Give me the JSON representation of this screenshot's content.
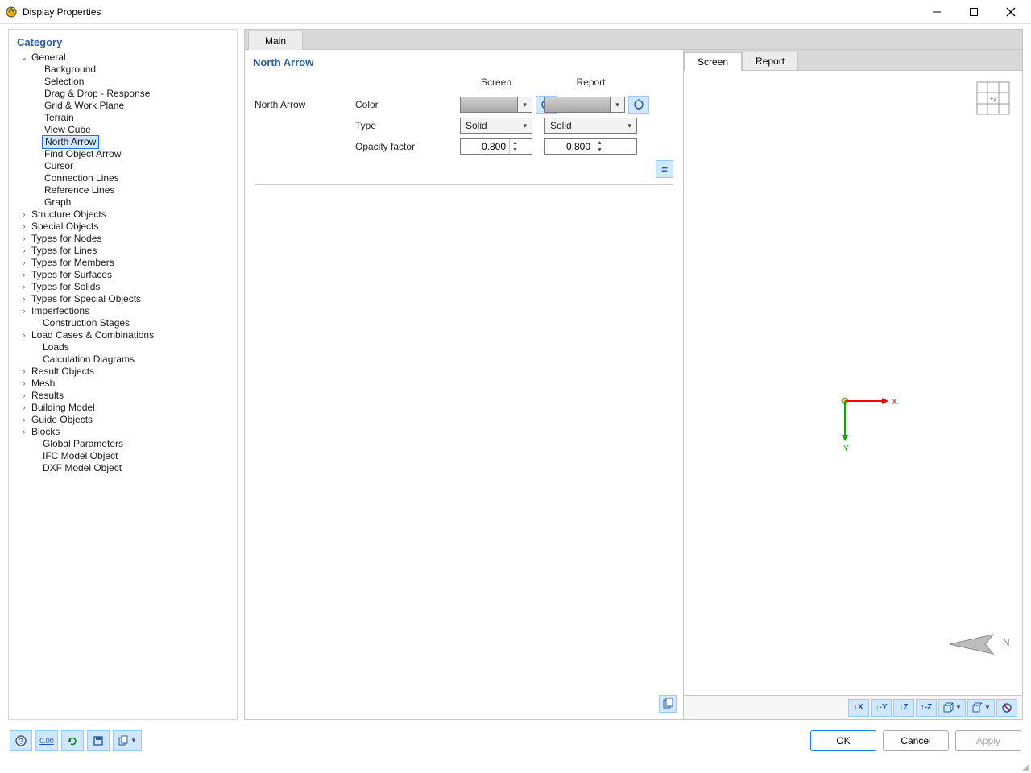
{
  "window": {
    "title": "Display Properties"
  },
  "sidebar": {
    "header": "Category",
    "tree": [
      {
        "label": "General",
        "level": 0,
        "expander": "v"
      },
      {
        "label": "Background",
        "level": 1
      },
      {
        "label": "Selection",
        "level": 1
      },
      {
        "label": "Drag & Drop - Response",
        "level": 1
      },
      {
        "label": "Grid & Work Plane",
        "level": 1
      },
      {
        "label": "Terrain",
        "level": 1
      },
      {
        "label": "View Cube",
        "level": 1
      },
      {
        "label": "North Arrow",
        "level": 1,
        "selected": true
      },
      {
        "label": "Find Object Arrow",
        "level": 1
      },
      {
        "label": "Cursor",
        "level": 1
      },
      {
        "label": "Connection Lines",
        "level": 1
      },
      {
        "label": "Reference Lines",
        "level": 1
      },
      {
        "label": "Graph",
        "level": 1
      },
      {
        "label": "Structure Objects",
        "level": 0,
        "expander": ">"
      },
      {
        "label": "Special Objects",
        "level": 0,
        "expander": ">"
      },
      {
        "label": "Types for Nodes",
        "level": 0,
        "expander": ">"
      },
      {
        "label": "Types for Lines",
        "level": 0,
        "expander": ">"
      },
      {
        "label": "Types for Members",
        "level": 0,
        "expander": ">"
      },
      {
        "label": "Types for Surfaces",
        "level": 0,
        "expander": ">"
      },
      {
        "label": "Types for Solids",
        "level": 0,
        "expander": ">"
      },
      {
        "label": "Types for Special Objects",
        "level": 0,
        "expander": ">"
      },
      {
        "label": "Imperfections",
        "level": 0,
        "expander": ">"
      },
      {
        "label": "Construction Stages",
        "level": 0
      },
      {
        "label": "Load Cases & Combinations",
        "level": 0,
        "expander": ">"
      },
      {
        "label": "Loads",
        "level": 0
      },
      {
        "label": "Calculation Diagrams",
        "level": 0
      },
      {
        "label": "Result Objects",
        "level": 0,
        "expander": ">"
      },
      {
        "label": "Mesh",
        "level": 0,
        "expander": ">"
      },
      {
        "label": "Results",
        "level": 0,
        "expander": ">"
      },
      {
        "label": "Building Model",
        "level": 0,
        "expander": ">"
      },
      {
        "label": "Guide Objects",
        "level": 0,
        "expander": ">"
      },
      {
        "label": "Blocks",
        "level": 0,
        "expander": ">"
      },
      {
        "label": "Global Parameters",
        "level": 0
      },
      {
        "label": "IFC Model Object",
        "level": 0
      },
      {
        "label": "DXF Model Object",
        "level": 0
      }
    ]
  },
  "tabs": {
    "main": "Main"
  },
  "settings": {
    "section": "North Arrow",
    "group_label": "North Arrow",
    "columns": {
      "screen": "Screen",
      "report": "Report"
    },
    "rows": {
      "color": {
        "label": "Color"
      },
      "type": {
        "label": "Type",
        "screen": "Solid",
        "report": "Solid"
      },
      "opacity": {
        "label": "Opacity factor",
        "screen": "0.800",
        "report": "0.800"
      }
    }
  },
  "preview": {
    "tabs": {
      "screen": "Screen",
      "report": "Report"
    },
    "axis": {
      "x": "X",
      "y": "Y"
    },
    "viewcube_label": "+z",
    "north_label": "N",
    "toolbar": {
      "view_x": "X",
      "view_y": "-Y",
      "view_z": "Z",
      "view_nz": "-Z"
    }
  },
  "buttons": {
    "ok": "OK",
    "cancel": "Cancel",
    "apply": "Apply"
  },
  "bottom_tools": {
    "units": "0.00"
  }
}
